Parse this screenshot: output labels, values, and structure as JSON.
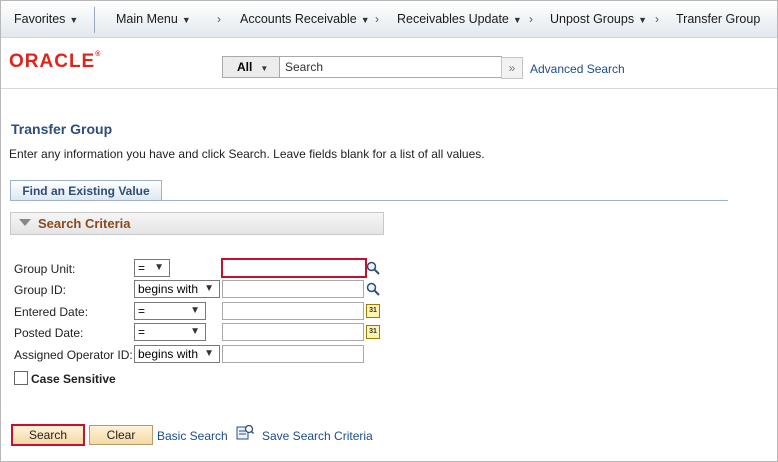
{
  "nav": {
    "items": [
      {
        "label": "Favorites",
        "dropdown": true
      },
      {
        "label": "Main Menu",
        "dropdown": true
      },
      {
        "label": "Accounts Receivable",
        "dropdown": true
      },
      {
        "label": "Receivables Update",
        "dropdown": true
      },
      {
        "label": "Unpost Groups",
        "dropdown": true
      },
      {
        "label": "Transfer Group",
        "dropdown": false
      }
    ],
    "separator": "›"
  },
  "header": {
    "logo_text": "ORACLE",
    "search_scope": "All",
    "search_placeholder": "Search",
    "go_icon": "double-chevron-right-icon",
    "advanced_search_label": "Advanced Search"
  },
  "page": {
    "title": "Transfer Group",
    "instructions": "Enter any information you have and click Search. Leave fields blank for a list of all values.",
    "tab_label": "Find an Existing Value",
    "section_label": "Search Criteria"
  },
  "fields": [
    {
      "label": "Group Unit:",
      "operator": "=",
      "value": "",
      "aux": "lookup"
    },
    {
      "label": "Group ID:",
      "operator": "begins with",
      "value": "",
      "aux": "lookup"
    },
    {
      "label": "Entered Date:",
      "operator": "=",
      "value": "",
      "aux": "calendar"
    },
    {
      "label": "Posted Date:",
      "operator": "=",
      "value": "",
      "aux": "calendar"
    },
    {
      "label": "Assigned Operator ID:",
      "operator": "begins with",
      "value": "",
      "aux": "none"
    }
  ],
  "calendar_glyph": "31",
  "case_sensitive": {
    "label": "Case Sensitive",
    "checked": false
  },
  "buttons": {
    "search_label": "Search",
    "clear_label": "Clear",
    "basic_search_label": "Basic Search",
    "save_criteria_label": "Save Search Criteria"
  },
  "colors": {
    "accent_red": "#c8102e",
    "title_blue": "#2d4e78",
    "section_brown": "#8b4a1c",
    "link_blue": "#1a4d8c",
    "oracle_red": "#e2231a"
  }
}
